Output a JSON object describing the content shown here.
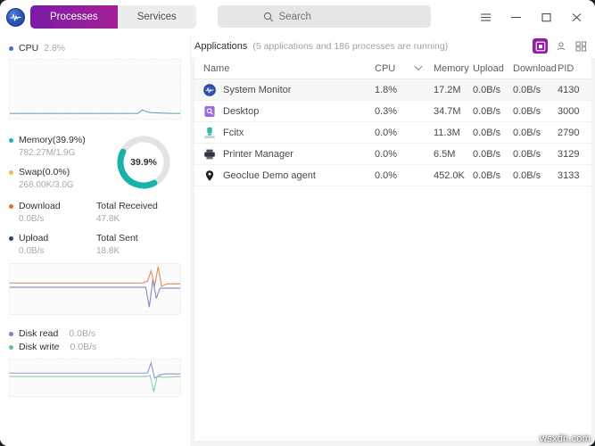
{
  "window": {
    "logo_icon": "activity-wave-icon",
    "tabs": [
      {
        "label": "Processes",
        "active": true
      },
      {
        "label": "Services",
        "active": false
      }
    ],
    "search": {
      "placeholder": "Search",
      "value": "",
      "icon": "search-icon"
    },
    "controls": {
      "menu": "hamburger-menu-icon",
      "minimize": "minimize-icon",
      "maximize": "maximize-icon",
      "close": "close-icon"
    }
  },
  "sidebar": {
    "cpu": {
      "label": "CPU",
      "value": "2.8%",
      "dot_color": "#3b6fd4",
      "line_color": "#6aa8b8"
    },
    "memory": {
      "label": "Memory(39.9%)",
      "detail": "782.27M/1.9G",
      "dot_color": "#19b9ad",
      "swap_label": "Swap(0.0%)",
      "swap_detail": "268.00K/3.0G",
      "swap_dot_color": "#e8c23d",
      "ring_percent": "39.9%",
      "ring_value": 39.9,
      "ring_color": "#17b3ab",
      "ring_track_color": "#e3e3e3"
    },
    "network": {
      "download_label": "Download",
      "download_value": "0.0B/s",
      "download_dot_color": "#d9722c",
      "total_received_label": "Total Received",
      "total_received_value": "47.8K",
      "upload_label": "Upload",
      "upload_value": "0.0B/s",
      "upload_dot_color": "#2b3f91",
      "total_sent_label": "Total Sent",
      "total_sent_value": "18.8K",
      "download_line_color": "#e08a5a",
      "upload_line_color": "#8088c8"
    },
    "disk": {
      "read_label": "Disk read",
      "read_value": "0.0B/s",
      "read_dot_color": "#7a7fd0",
      "write_label": "Disk write",
      "write_value": "0.0B/s",
      "write_dot_color": "#5fc08a",
      "read_line_color": "#8f93d4",
      "write_line_color": "#86cfa0"
    }
  },
  "main": {
    "section_title": "Applications",
    "section_count": "(5 applications and 186 processes are running)",
    "view_buttons": [
      {
        "icon": "applications-view-icon",
        "active": true
      },
      {
        "icon": "user-processes-icon",
        "active": false
      },
      {
        "icon": "all-processes-icon",
        "active": false
      }
    ],
    "columns": {
      "name": "Name",
      "cpu": "CPU",
      "memory": "Memory",
      "upload": "Upload",
      "download": "Download",
      "pid": "PID",
      "sort_icon": "chevron-down-icon"
    },
    "rows": [
      {
        "icon": "system-monitor-icon",
        "name": "System Monitor",
        "cpu": "1.8%",
        "memory": "17.2M",
        "upload": "0.0B/s",
        "download": "0.0B/s",
        "pid": "4130",
        "selected": true
      },
      {
        "icon": "desktop-search-icon",
        "name": "Desktop",
        "cpu": "0.3%",
        "memory": "34.7M",
        "upload": "0.0B/s",
        "download": "0.0B/s",
        "pid": "3000",
        "selected": false
      },
      {
        "icon": "fcitx-keyboard-icon",
        "name": "Fcitx",
        "cpu": "0.0%",
        "memory": "11.3M",
        "upload": "0.0B/s",
        "download": "0.0B/s",
        "pid": "2790",
        "selected": false
      },
      {
        "icon": "printer-icon",
        "name": "Printer Manager",
        "cpu": "0.0%",
        "memory": "6.5M",
        "upload": "0.0B/s",
        "download": "0.0B/s",
        "pid": "3129",
        "selected": false
      },
      {
        "icon": "location-pin-icon",
        "name": "Geoclue Demo agent",
        "cpu": "0.0%",
        "memory": "452.0K",
        "upload": "0.0B/s",
        "download": "0.0B/s",
        "pid": "3133",
        "selected": false
      }
    ]
  },
  "watermark": {
    "text": "wsxdn.com"
  }
}
